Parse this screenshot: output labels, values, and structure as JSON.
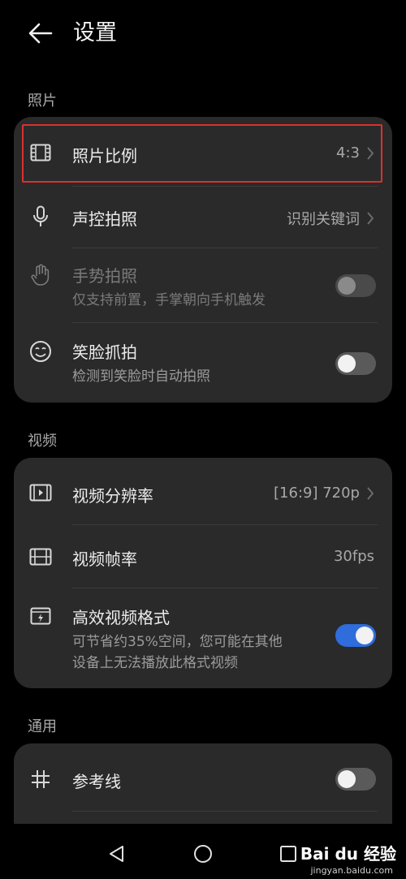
{
  "header": {
    "title": "设置"
  },
  "sections": {
    "photo": "照片",
    "video": "视频",
    "general": "通用"
  },
  "photo_card": {
    "aspect": {
      "label": "照片比例",
      "value": "4:3"
    },
    "voice": {
      "label": "声控拍照",
      "value": "识别关键词"
    },
    "gesture": {
      "label": "手势拍照",
      "sub": "仅支持前置，手掌朝向手机触发",
      "enabled": false,
      "on": false
    },
    "smile": {
      "label": "笑脸抓拍",
      "sub": "检测到笑脸时自动拍照",
      "on": false
    }
  },
  "video_card": {
    "resolution": {
      "label": "视频分辨率",
      "value": "[16:9] 720p"
    },
    "framerate": {
      "label": "视频帧率",
      "value": "30fps"
    },
    "efficient": {
      "label": "高效视频格式",
      "sub1": "可节省约35%空间，您可能在其他",
      "sub2": "设备上无法播放此格式视频",
      "on": true
    }
  },
  "general_card": {
    "grid": {
      "label": "参考线",
      "on": false
    }
  },
  "watermark": {
    "brand": "Bai du 经验",
    "url": "jingyan.baidu.com"
  },
  "colors": {
    "background": "#000000",
    "card": "#2a2a2a",
    "accent": "#2f6cdc",
    "highlight_border": "#d9312f"
  }
}
